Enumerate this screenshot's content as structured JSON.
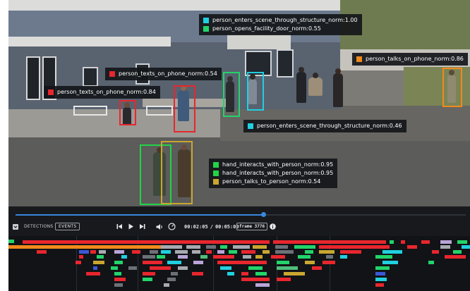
{
  "detections": [
    {
      "label": "person_texts_on_phone_norm:0.84",
      "color": "#e8262e"
    },
    {
      "label": "person_texts_on_phone_norm:0.54",
      "color": "#e8262e"
    },
    {
      "label": "person_enters_scene_through_structure_norm:1.00",
      "color": "#20d0e0"
    },
    {
      "label": "person_opens_facility_door_norm:0.55",
      "color": "#22d46a"
    },
    {
      "label": "person_talks_on_phone_norm:0.86",
      "color": "#f08a1c"
    },
    {
      "label": "person_enters_scene_through_structure_norm:0.46",
      "color": "#20d0e0"
    },
    {
      "label": "hand_interacts_with_person_norm:0.95",
      "color": "#22d446"
    },
    {
      "label": "hand_interacts_with_person_norm:0.95",
      "color": "#22d446"
    },
    {
      "label": "person_talks_to_person_norm:0.54",
      "color": "#c9a630"
    }
  ],
  "controls": {
    "detections_tab": "DETECTIONS",
    "events_tab": "EVENTS",
    "current_time": "00:02:05",
    "separator": "/",
    "total_time": "00:05:00",
    "frame_label": "frame 3776",
    "playback_progress": 0.55
  },
  "icons": {
    "checkbox": "checkbox-icon",
    "skip_back": "skip-back-icon",
    "play": "play-icon",
    "skip_forward": "skip-forward-icon",
    "volume": "volume-icon",
    "speed": "speed-gauge-icon",
    "info": "info-icon"
  },
  "colors": {
    "red": "#e8262e",
    "orange": "#f08a1c",
    "green": "#22d46a",
    "cyan": "#20d0e0",
    "gold": "#c9a630",
    "accent": "#3a86e0"
  }
}
